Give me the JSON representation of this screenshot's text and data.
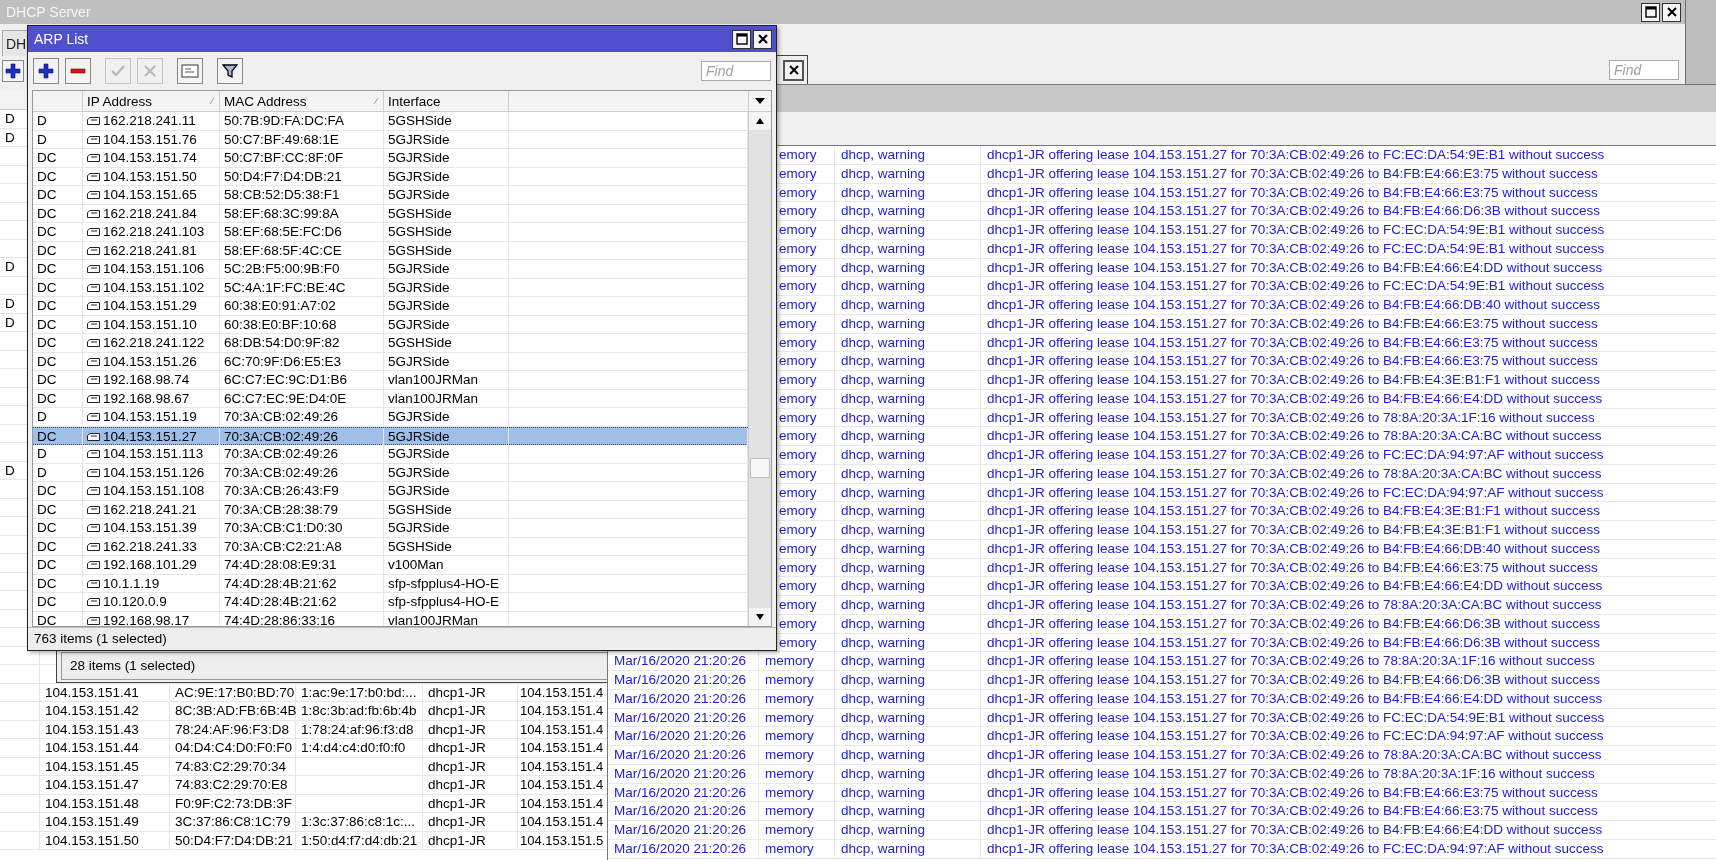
{
  "dhcp_window": {
    "title": "DHCP Server",
    "tab": "DH",
    "find": {
      "placeholder": "Find"
    },
    "leases": {
      "rows": [
        {
          "flag": "D"
        },
        {
          "flag": "D"
        },
        {},
        {},
        {},
        {},
        {},
        {},
        {
          "flag": "D"
        },
        {},
        {
          "flag": "D"
        },
        {
          "flag": "D"
        },
        {},
        {},
        {},
        {},
        {},
        {},
        {},
        {
          "flag": "D"
        },
        {},
        {},
        {},
        {},
        {},
        {},
        {},
        {},
        {},
        {},
        {},
        {
          "address": "104.153.151.41",
          "mac": "AC:9E:17:B0:BD:70",
          "client_id": "1:ac:9e:17:b0:bd:...",
          "server": "dhcp1-JR",
          "active_address": "104.153.151.4"
        },
        {
          "address": "104.153.151.42",
          "mac": "8C:3B:AD:FB:6B:4B",
          "client_id": "1:8c:3b:ad:fb:6b:4b",
          "server": "dhcp1-JR",
          "active_address": "104.153.151.4"
        },
        {
          "address": "104.153.151.43",
          "mac": "78:24:AF:96:F3:D8",
          "client_id": "1:78:24:af:96:f3:d8",
          "server": "dhcp1-JR",
          "active_address": "104.153.151.4"
        },
        {
          "address": "104.153.151.44",
          "mac": "04:D4:C4:D0:F0:F0",
          "client_id": "1:4:d4:c4:d0:f0:f0",
          "server": "dhcp1-JR",
          "active_address": "104.153.151.4"
        },
        {
          "address": "104.153.151.45",
          "mac": "74:83:C2:29:70:34",
          "server": "dhcp1-JR",
          "active_address": "104.153.151.4"
        },
        {
          "address": "104.153.151.47",
          "mac": "74:83:C2:29:70:E8",
          "server": "dhcp1-JR",
          "active_address": "104.153.151.4"
        },
        {
          "address": "104.153.151.48",
          "mac": "F0:9F:C2:73:DB:3F",
          "server": "dhcp1-JR",
          "active_address": "104.153.151.4"
        },
        {
          "address": "104.153.151.49",
          "mac": "3C:37:86:C8:1C:79",
          "client_id": "1:3c:37:86:c8:1c:...",
          "server": "dhcp1-JR",
          "active_address": "104.153.151.4"
        },
        {
          "address": "104.153.151.50",
          "mac": "50:D4:F7:D4:DB:21",
          "client_id": "1:50:d4:f7:d4:db:21",
          "server": "dhcp1-JR",
          "active_address": "104.153.151.5"
        }
      ]
    }
  },
  "lease_window": {
    "status": "28 items (1 selected)"
  },
  "log_window": {
    "rows": [
      {
        "buffer": "emory",
        "topics": "dhcp, warning",
        "message": "dhcp1-JR offering lease 104.153.151.27 for 70:3A:CB:02:49:26 to FC:EC:DA:54:9E:B1 without success"
      },
      {
        "buffer": "emory",
        "topics": "dhcp, warning",
        "message": "dhcp1-JR offering lease 104.153.151.27 for 70:3A:CB:02:49:26 to B4:FB:E4:66:E3:75 without success"
      },
      {
        "buffer": "emory",
        "topics": "dhcp, warning",
        "message": "dhcp1-JR offering lease 104.153.151.27 for 70:3A:CB:02:49:26 to B4:FB:E4:66:E3:75 without success"
      },
      {
        "buffer": "emory",
        "topics": "dhcp, warning",
        "message": "dhcp1-JR offering lease 104.153.151.27 for 70:3A:CB:02:49:26 to B4:FB:E4:66:D6:3B without success"
      },
      {
        "buffer": "emory",
        "topics": "dhcp, warning",
        "message": "dhcp1-JR offering lease 104.153.151.27 for 70:3A:CB:02:49:26 to FC:EC:DA:54:9E:B1 without success"
      },
      {
        "buffer": "emory",
        "topics": "dhcp, warning",
        "message": "dhcp1-JR offering lease 104.153.151.27 for 70:3A:CB:02:49:26 to FC:EC:DA:54:9E:B1 without success"
      },
      {
        "buffer": "emory",
        "topics": "dhcp, warning",
        "message": "dhcp1-JR offering lease 104.153.151.27 for 70:3A:CB:02:49:26 to B4:FB:E4:66:E4:DD without success"
      },
      {
        "buffer": "emory",
        "topics": "dhcp, warning",
        "message": "dhcp1-JR offering lease 104.153.151.27 for 70:3A:CB:02:49:26 to FC:EC:DA:54:9E:B1 without success"
      },
      {
        "buffer": "emory",
        "topics": "dhcp, warning",
        "message": "dhcp1-JR offering lease 104.153.151.27 for 70:3A:CB:02:49:26 to B4:FB:E4:66:DB:40 without success"
      },
      {
        "buffer": "emory",
        "topics": "dhcp, warning",
        "message": "dhcp1-JR offering lease 104.153.151.27 for 70:3A:CB:02:49:26 to B4:FB:E4:66:E3:75 without success"
      },
      {
        "buffer": "emory",
        "topics": "dhcp, warning",
        "message": "dhcp1-JR offering lease 104.153.151.27 for 70:3A:CB:02:49:26 to B4:FB:E4:66:E3:75 without success"
      },
      {
        "buffer": "emory",
        "topics": "dhcp, warning",
        "message": "dhcp1-JR offering lease 104.153.151.27 for 70:3A:CB:02:49:26 to B4:FB:E4:66:E3:75 without success"
      },
      {
        "buffer": "emory",
        "topics": "dhcp, warning",
        "message": "dhcp1-JR offering lease 104.153.151.27 for 70:3A:CB:02:49:26 to B4:FB:E4:3E:B1:F1 without success"
      },
      {
        "buffer": "emory",
        "topics": "dhcp, warning",
        "message": "dhcp1-JR offering lease 104.153.151.27 for 70:3A:CB:02:49:26 to B4:FB:E4:66:E4:DD without success"
      },
      {
        "buffer": "emory",
        "topics": "dhcp, warning",
        "message": "dhcp1-JR offering lease 104.153.151.27 for 70:3A:CB:02:49:26 to 78:8A:20:3A:1F:16 without success"
      },
      {
        "buffer": "emory",
        "topics": "dhcp, warning",
        "message": "dhcp1-JR offering lease 104.153.151.27 for 70:3A:CB:02:49:26 to 78:8A:20:3A:CA:BC without success"
      },
      {
        "buffer": "emory",
        "topics": "dhcp, warning",
        "message": "dhcp1-JR offering lease 104.153.151.27 for 70:3A:CB:02:49:26 to FC:EC:DA:94:97:AF without success"
      },
      {
        "buffer": "emory",
        "topics": "dhcp, warning",
        "message": "dhcp1-JR offering lease 104.153.151.27 for 70:3A:CB:02:49:26 to 78:8A:20:3A:CA:BC without success"
      },
      {
        "buffer": "emory",
        "topics": "dhcp, warning",
        "message": "dhcp1-JR offering lease 104.153.151.27 for 70:3A:CB:02:49:26 to FC:EC:DA:94:97:AF without success"
      },
      {
        "buffer": "emory",
        "topics": "dhcp, warning",
        "message": "dhcp1-JR offering lease 104.153.151.27 for 70:3A:CB:02:49:26 to B4:FB:E4:3E:B1:F1 without success"
      },
      {
        "buffer": "emory",
        "topics": "dhcp, warning",
        "message": "dhcp1-JR offering lease 104.153.151.27 for 70:3A:CB:02:49:26 to B4:FB:E4:3E:B1:F1 without success"
      },
      {
        "buffer": "emory",
        "topics": "dhcp, warning",
        "message": "dhcp1-JR offering lease 104.153.151.27 for 70:3A:CB:02:49:26 to B4:FB:E4:66:DB:40 without success"
      },
      {
        "buffer": "emory",
        "topics": "dhcp, warning",
        "message": "dhcp1-JR offering lease 104.153.151.27 for 70:3A:CB:02:49:26 to B4:FB:E4:66:E3:75 without success"
      },
      {
        "buffer": "emory",
        "topics": "dhcp, warning",
        "message": "dhcp1-JR offering lease 104.153.151.27 for 70:3A:CB:02:49:26 to B4:FB:E4:66:E4:DD without success"
      },
      {
        "buffer": "emory",
        "topics": "dhcp, warning",
        "message": "dhcp1-JR offering lease 104.153.151.27 for 70:3A:CB:02:49:26 to 78:8A:20:3A:CA:BC without success"
      },
      {
        "buffer": "emory",
        "topics": "dhcp, warning",
        "message": "dhcp1-JR offering lease 104.153.151.27 for 70:3A:CB:02:49:26 to B4:FB:E4:66:D6:3B without success"
      },
      {
        "buffer": "emory",
        "topics": "dhcp, warning",
        "message": "dhcp1-JR offering lease 104.153.151.27 for 70:3A:CB:02:49:26 to B4:FB:E4:66:D6:3B without success"
      },
      {
        "time": "Mar/16/2020 21:20:26",
        "buffer": "memory",
        "topics": "dhcp, warning",
        "message": "dhcp1-JR offering lease 104.153.151.27 for 70:3A:CB:02:49:26 to 78:8A:20:3A:1F:16 without success"
      },
      {
        "time": "Mar/16/2020 21:20:26",
        "buffer": "memory",
        "topics": "dhcp, warning",
        "message": "dhcp1-JR offering lease 104.153.151.27 for 70:3A:CB:02:49:26 to B4:FB:E4:66:D6:3B without success"
      },
      {
        "time": "Mar/16/2020 21:20:26",
        "buffer": "memory",
        "topics": "dhcp, warning",
        "message": "dhcp1-JR offering lease 104.153.151.27 for 70:3A:CB:02:49:26 to B4:FB:E4:66:E4:DD without success"
      },
      {
        "time": "Mar/16/2020 21:20:26",
        "buffer": "memory",
        "topics": "dhcp, warning",
        "message": "dhcp1-JR offering lease 104.153.151.27 for 70:3A:CB:02:49:26 to FC:EC:DA:54:9E:B1 without success"
      },
      {
        "time": "Mar/16/2020 21:20:26",
        "buffer": "memory",
        "topics": "dhcp, warning",
        "message": "dhcp1-JR offering lease 104.153.151.27 for 70:3A:CB:02:49:26 to FC:EC:DA:94:97:AF without success"
      },
      {
        "time": "Mar/16/2020 21:20:26",
        "buffer": "memory",
        "topics": "dhcp, warning",
        "message": "dhcp1-JR offering lease 104.153.151.27 for 70:3A:CB:02:49:26 to 78:8A:20:3A:CA:BC without success"
      },
      {
        "time": "Mar/16/2020 21:20:26",
        "buffer": "memory",
        "topics": "dhcp, warning",
        "message": "dhcp1-JR offering lease 104.153.151.27 for 70:3A:CB:02:49:26 to 78:8A:20:3A:1F:16 without success"
      },
      {
        "time": "Mar/16/2020 21:20:26",
        "buffer": "memory",
        "topics": "dhcp, warning",
        "message": "dhcp1-JR offering lease 104.153.151.27 for 70:3A:CB:02:49:26 to B4:FB:E4:66:E3:75 without success"
      },
      {
        "time": "Mar/16/2020 21:20:26",
        "buffer": "memory",
        "topics": "dhcp, warning",
        "message": "dhcp1-JR offering lease 104.153.151.27 for 70:3A:CB:02:49:26 to B4:FB:E4:66:E3:75 without success"
      },
      {
        "time": "Mar/16/2020 21:20:26",
        "buffer": "memory",
        "topics": "dhcp, warning",
        "message": "dhcp1-JR offering lease 104.153.151.27 for 70:3A:CB:02:49:26 to B4:FB:E4:66:E4:DD without success"
      },
      {
        "time": "Mar/16/2020 21:20:26",
        "buffer": "memory",
        "topics": "dhcp, warning",
        "message": "dhcp1-JR offering lease 104.153.151.27 for 70:3A:CB:02:49:26 to FC:EC:DA:94:97:AF without success"
      }
    ]
  },
  "arp_window": {
    "title": "ARP List",
    "toolbar": [
      {
        "kind": "add",
        "disabled": false
      },
      {
        "kind": "remove",
        "disabled": false
      },
      {
        "kind": "enable",
        "disabled": true
      },
      {
        "kind": "disable",
        "disabled": true
      },
      {
        "kind": "comment",
        "disabled": false
      },
      {
        "kind": "filter",
        "disabled": false
      }
    ],
    "find": {
      "placeholder": "Find"
    },
    "columns": [
      {
        "label": "IP Address",
        "sorted": true
      },
      {
        "label": "MAC Address",
        "sorted": true
      },
      {
        "label": "Interface",
        "sorted": false
      }
    ],
    "rows": [
      {
        "flags": "D",
        "ip": "162.218.241.11",
        "mac": "50:7B:9D:FA:DC:FA",
        "interface": "5GSHSide",
        "selected": false
      },
      {
        "flags": "D",
        "ip": "104.153.151.76",
        "mac": "50:C7:BF:49:68:1E",
        "interface": "5GJRSide",
        "selected": false
      },
      {
        "flags": "DC",
        "ip": "104.153.151.74",
        "mac": "50:C7:BF:CC:8F:0F",
        "interface": "5GJRSide",
        "selected": false
      },
      {
        "flags": "DC",
        "ip": "104.153.151.50",
        "mac": "50:D4:F7:D4:DB:21",
        "interface": "5GJRSide",
        "selected": false
      },
      {
        "flags": "DC",
        "ip": "104.153.151.65",
        "mac": "58:CB:52:D5:38:F1",
        "interface": "5GJRSide",
        "selected": false
      },
      {
        "flags": "DC",
        "ip": "162.218.241.84",
        "mac": "58:EF:68:3C:99:8A",
        "interface": "5GSHSide",
        "selected": false
      },
      {
        "flags": "DC",
        "ip": "162.218.241.103",
        "mac": "58:EF:68:5E:FC:D6",
        "interface": "5GSHSide",
        "selected": false
      },
      {
        "flags": "DC",
        "ip": "162.218.241.81",
        "mac": "58:EF:68:5F:4C:CE",
        "interface": "5GSHSide",
        "selected": false
      },
      {
        "flags": "DC",
        "ip": "104.153.151.106",
        "mac": "5C:2B:F5:00:9B:F0",
        "interface": "5GJRSide",
        "selected": false
      },
      {
        "flags": "DC",
        "ip": "104.153.151.102",
        "mac": "5C:4A:1F:FC:BE:4C",
        "interface": "5GJRSide",
        "selected": false
      },
      {
        "flags": "DC",
        "ip": "104.153.151.29",
        "mac": "60:38:E0:91:A7:02",
        "interface": "5GJRSide",
        "selected": false
      },
      {
        "flags": "DC",
        "ip": "104.153.151.10",
        "mac": "60:38:E0:BF:10:68",
        "interface": "5GJRSide",
        "selected": false
      },
      {
        "flags": "DC",
        "ip": "162.218.241.122",
        "mac": "68:DB:54:D0:9F:82",
        "interface": "5GSHSide",
        "selected": false
      },
      {
        "flags": "DC",
        "ip": "104.153.151.26",
        "mac": "6C:70:9F:D6:E5:E3",
        "interface": "5GJRSide",
        "selected": false
      },
      {
        "flags": "DC",
        "ip": "192.168.98.74",
        "mac": "6C:C7:EC:9C:D1:B6",
        "interface": "vlan100JRMan",
        "selected": false
      },
      {
        "flags": "DC",
        "ip": "192.168.98.67",
        "mac": "6C:C7:EC:9E:D4:0E",
        "interface": "vlan100JRMan",
        "selected": false
      },
      {
        "flags": "D",
        "ip": "104.153.151.19",
        "mac": "70:3A:CB:02:49:26",
        "interface": "5GJRSide",
        "selected": false
      },
      {
        "flags": "DC",
        "ip": "104.153.151.27",
        "mac": "70:3A:CB:02:49:26",
        "interface": "5GJRSide",
        "selected": true
      },
      {
        "flags": "D",
        "ip": "104.153.151.113",
        "mac": "70:3A:CB:02:49:26",
        "interface": "5GJRSide",
        "selected": false
      },
      {
        "flags": "D",
        "ip": "104.153.151.126",
        "mac": "70:3A:CB:02:49:26",
        "interface": "5GJRSide",
        "selected": false
      },
      {
        "flags": "DC",
        "ip": "104.153.151.108",
        "mac": "70:3A:CB:26:43:F9",
        "interface": "5GJRSide",
        "selected": false
      },
      {
        "flags": "DC",
        "ip": "162.218.241.21",
        "mac": "70:3A:CB:28:38:79",
        "interface": "5GSHSide",
        "selected": false
      },
      {
        "flags": "DC",
        "ip": "104.153.151.39",
        "mac": "70:3A:CB:C1:D0:30",
        "interface": "5GJRSide",
        "selected": false
      },
      {
        "flags": "DC",
        "ip": "162.218.241.33",
        "mac": "70:3A:CB:C2:21:A8",
        "interface": "5GSHSide",
        "selected": false
      },
      {
        "flags": "DC",
        "ip": "192.168.101.29",
        "mac": "74:4D:28:08:E9:31",
        "interface": "v100Man",
        "selected": false
      },
      {
        "flags": "DC",
        "ip": "10.1.1.19",
        "mac": "74:4D:28:4B:21:62",
        "interface": "sfp-sfpplus4-HO-E",
        "selected": false
      },
      {
        "flags": "DC",
        "ip": "10.120.0.9",
        "mac": "74:4D:28:4B:21:62",
        "interface": "sfp-sfpplus4-HO-E",
        "selected": false
      },
      {
        "flags": "DC",
        "ip": "192.168.98.17",
        "mac": "74:4D:28:86:33:16",
        "interface": "vlan100JRMan",
        "selected": false
      }
    ],
    "status": "763 items (1 selected)"
  }
}
